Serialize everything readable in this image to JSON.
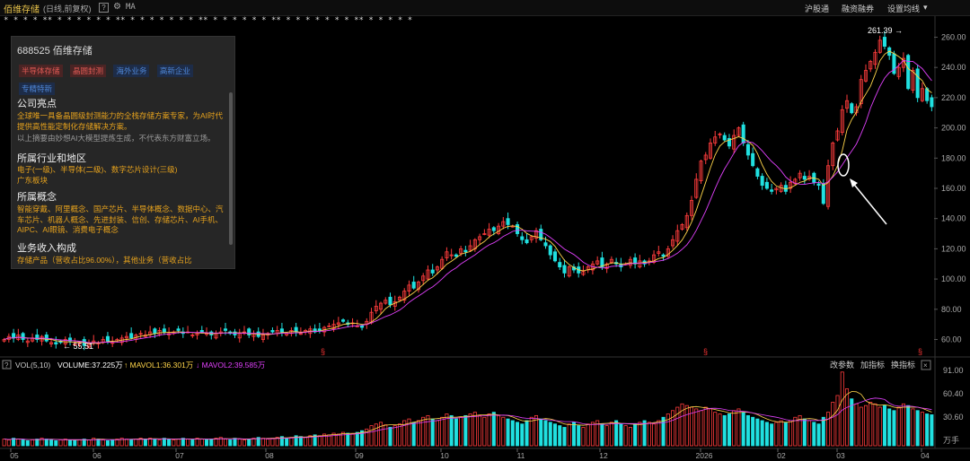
{
  "header": {
    "stock_name": "佰维存储",
    "mode": "(日线,前复权)",
    "indicator": "MA",
    "links": [
      "沪股通",
      "融资融券",
      "设置均线"
    ]
  },
  "info_panel": {
    "code_name": "688525 佰维存储",
    "tags": [
      {
        "text": "半导体存储",
        "c": "r"
      },
      {
        "text": "晶圆封测",
        "c": "r"
      },
      {
        "text": "海外业务",
        "c": "b"
      },
      {
        "text": "高新企业",
        "c": "b"
      },
      {
        "text": "专精特新",
        "c": "b"
      }
    ],
    "sec1_title": "公司亮点",
    "sec1_text": "全球唯一具备晶圆级封测能力的全栈存储方案专家，为AI时代提供高性能定制化存储解决方案。",
    "sec1_note": "以上摘要由妙想AI大模型提炼生成，不代表东方财富立场。",
    "sec2_title": "所属行业和地区",
    "sec2_text1": "电子(一级)、半导体(二级)、数字芯片设计(三级)",
    "sec2_text2": "广东板块",
    "sec3_title": "所属概念",
    "sec3_text": "智能穿戴、阿里概念、国产芯片、半导体概念、数据中心、汽车芯片、机器人概念、先进封装、信创、存储芯片、AI手机、AIPC、AI眼镜、消费电子概念",
    "sec4_title": "业务收入构成",
    "sec4_text": "存储产品（营收占比96.00%），其他业务（营收占比"
  },
  "price_axis": [
    "260.00",
    "240.00",
    "220.00",
    "200.00",
    "180.00",
    "160.00",
    "140.00",
    "120.00",
    "100.00",
    "80.00",
    "60.00"
  ],
  "annotations": {
    "high": "261.39 →",
    "low": "← 55.51"
  },
  "volume_header": {
    "label": "VOL(5,10)",
    "volume": "VOLUME:37.225万",
    "mavol1": "MAVOL1:36.301万",
    "mavol2": "MAVOL2:39.585万",
    "buttons": [
      "改参数",
      "加指标",
      "换指标"
    ]
  },
  "volume_axis": [
    "91.00",
    "60.40",
    "30.60",
    "万手"
  ],
  "time_axis": [
    "05",
    "06",
    "07",
    "08",
    "09",
    "10",
    "11",
    "12",
    "2026",
    "02",
    "03",
    "04"
  ],
  "colors": {
    "up": "#ff3c3c",
    "down": "#20e0e0",
    "ma1": "#ffd54a",
    "ma2": "#e040fb",
    "bg": "#000000"
  },
  "chart_data": {
    "type": "candlestick",
    "ylim": [
      52,
      268
    ],
    "closes": [
      60,
      62,
      61,
      63,
      60,
      59,
      61,
      60,
      62,
      59,
      58,
      57,
      58,
      60,
      59,
      57,
      58,
      56,
      57,
      59,
      58,
      60,
      59,
      58,
      60,
      61,
      62,
      61,
      63,
      64,
      63,
      65,
      64,
      66,
      65,
      64,
      65,
      66,
      64,
      65,
      63,
      64,
      65,
      64,
      63,
      64,
      65,
      66,
      64,
      63,
      64,
      65,
      63,
      64,
      62,
      63,
      64,
      65,
      66,
      65,
      64,
      66,
      65,
      64,
      66,
      67,
      65,
      66,
      68,
      69,
      70,
      71,
      72,
      70,
      71,
      69,
      68,
      72,
      78,
      82,
      84,
      86,
      83,
      85,
      88,
      92,
      96,
      94,
      98,
      102,
      106,
      104,
      108,
      113,
      118,
      116,
      115,
      120,
      118,
      122,
      126,
      128,
      130,
      133,
      132,
      135,
      138,
      136,
      135,
      130,
      126,
      124,
      128,
      132,
      126,
      122,
      116,
      112,
      108,
      104,
      108,
      106,
      104,
      105,
      108,
      110,
      112,
      108,
      110,
      113,
      110,
      108,
      110,
      113,
      110,
      112,
      110,
      112,
      116,
      118,
      115,
      120,
      126,
      132,
      136,
      142,
      152,
      166,
      178,
      182,
      190,
      194,
      196,
      192,
      188,
      195,
      200,
      190,
      182,
      175,
      168,
      162,
      160,
      158,
      160,
      162,
      158,
      164,
      166,
      170,
      166,
      168,
      164,
      162,
      150,
      175,
      190,
      198,
      212,
      218,
      210,
      214,
      232,
      238,
      244,
      250,
      258,
      254,
      248,
      236,
      240,
      246,
      226,
      238,
      220,
      226,
      218,
      214
    ],
    "volumes": [
      8,
      7,
      9,
      8,
      7,
      6,
      7,
      8,
      9,
      8,
      7,
      6,
      7,
      8,
      7,
      6,
      7,
      8,
      7,
      9,
      8,
      7,
      6,
      7,
      8,
      9,
      8,
      7,
      8,
      9,
      8,
      9,
      8,
      7,
      9,
      8,
      7,
      8,
      9,
      8,
      7,
      9,
      8,
      7,
      8,
      9,
      10,
      8,
      7,
      9,
      8,
      7,
      8,
      9,
      10,
      9,
      8,
      9,
      10,
      11,
      9,
      10,
      12,
      11,
      10,
      12,
      13,
      12,
      14,
      13,
      15,
      14,
      16,
      15,
      14,
      16,
      18,
      20,
      24,
      26,
      28,
      25,
      22,
      24,
      26,
      30,
      32,
      28,
      30,
      34,
      36,
      32,
      30,
      34,
      38,
      36,
      32,
      34,
      36,
      38,
      40,
      36,
      34,
      38,
      40,
      36,
      34,
      32,
      30,
      28,
      26,
      30,
      34,
      36,
      32,
      30,
      28,
      26,
      24,
      22,
      26,
      28,
      24,
      22,
      26,
      28,
      30,
      26,
      24,
      28,
      30,
      26,
      24,
      22,
      26,
      28,
      30,
      28,
      26,
      30,
      34,
      38,
      42,
      46,
      50,
      48,
      46,
      44,
      42,
      46,
      44,
      40,
      38,
      36,
      38,
      42,
      44,
      40,
      36,
      34,
      32,
      30,
      28,
      26,
      28,
      30,
      28,
      30,
      34,
      36,
      32,
      30,
      28,
      26,
      34,
      40,
      52,
      60,
      88,
      68,
      56,
      50,
      46,
      48,
      52,
      50,
      46,
      48,
      44,
      42,
      46,
      50,
      48,
      44,
      42,
      40,
      38,
      37
    ]
  }
}
